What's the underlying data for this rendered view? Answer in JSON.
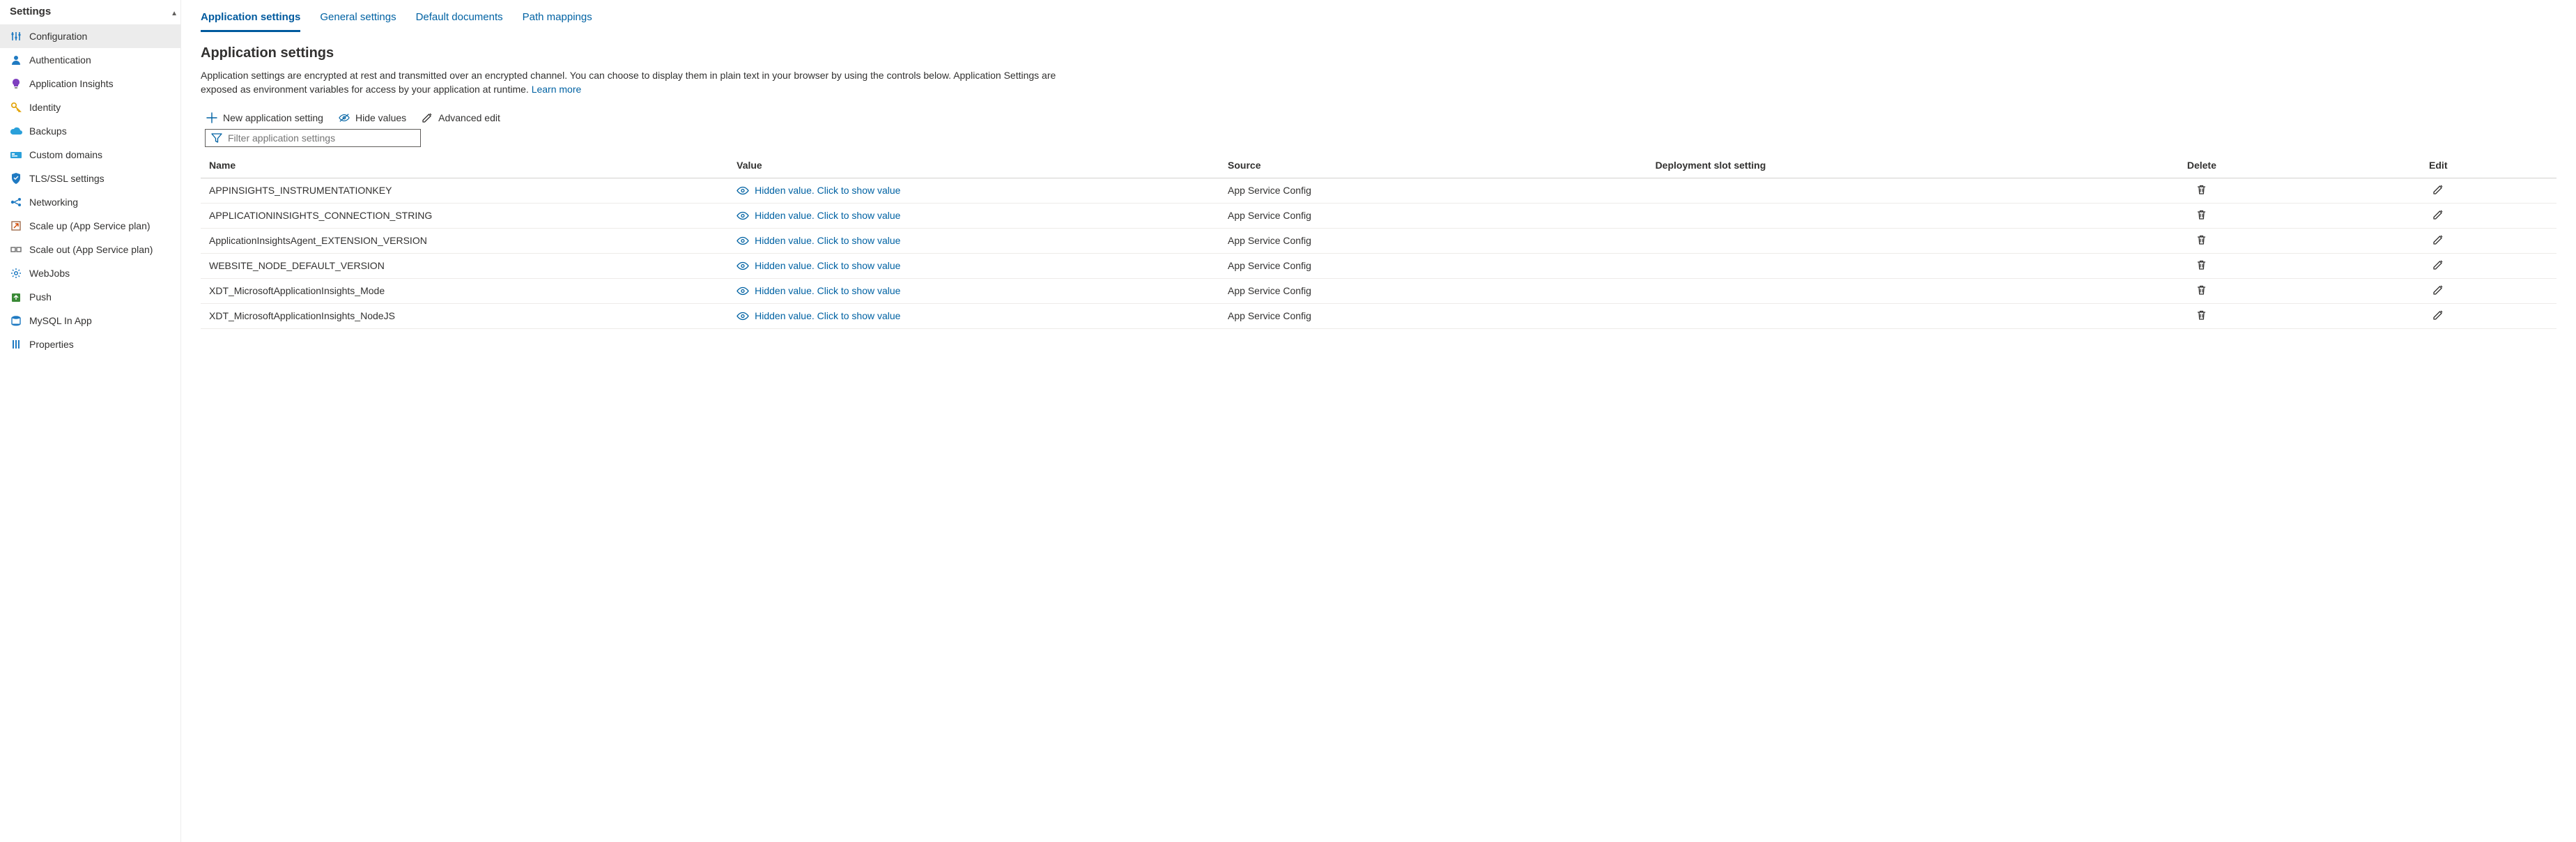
{
  "sidebar": {
    "title": "Settings",
    "items": [
      {
        "label": "Configuration",
        "icon": "sliders",
        "color": "#1f7ac2",
        "active": true
      },
      {
        "label": "Authentication",
        "icon": "person",
        "color": "#1f7ac2",
        "active": false
      },
      {
        "label": "Application Insights",
        "icon": "bulb",
        "color": "#7e3fbf",
        "active": false
      },
      {
        "label": "Identity",
        "icon": "key",
        "color": "#e2a100",
        "active": false
      },
      {
        "label": "Backups",
        "icon": "cloud",
        "color": "#2aa0da",
        "active": false
      },
      {
        "label": "Custom domains",
        "icon": "domains",
        "color": "#2aa0da",
        "active": false
      },
      {
        "label": "TLS/SSL settings",
        "icon": "shield",
        "color": "#1f7ac2",
        "active": false
      },
      {
        "label": "Networking",
        "icon": "network",
        "color": "#1f7ac2",
        "active": false
      },
      {
        "label": "Scale up (App Service plan)",
        "icon": "scaleup",
        "color": "#a06b4d",
        "active": false
      },
      {
        "label": "Scale out (App Service plan)",
        "icon": "scaleout",
        "color": "#6a6a6a",
        "active": false
      },
      {
        "label": "WebJobs",
        "icon": "gear",
        "color": "#1f7ac2",
        "active": false
      },
      {
        "label": "Push",
        "icon": "push",
        "color": "#3a8a36",
        "active": false
      },
      {
        "label": "MySQL In App",
        "icon": "database",
        "color": "#1f7ac2",
        "active": false
      },
      {
        "label": "Properties",
        "icon": "properties",
        "color": "#1f7ac2",
        "active": false
      }
    ]
  },
  "tabs": [
    {
      "label": "Application settings",
      "active": true
    },
    {
      "label": "General settings",
      "active": false
    },
    {
      "label": "Default documents",
      "active": false
    },
    {
      "label": "Path mappings",
      "active": false
    }
  ],
  "section": {
    "title": "Application settings",
    "description_pre": "Application settings are encrypted at rest and transmitted over an encrypted channel. You can choose to display them in plain text in your browser by using the controls below. Application Settings are exposed as environment variables for access by your application at runtime. ",
    "learn_more": "Learn more"
  },
  "toolbar": {
    "new_setting": "New application setting",
    "hide_values": "Hide values",
    "advanced_edit": "Advanced edit"
  },
  "filter": {
    "placeholder": "Filter application settings"
  },
  "table": {
    "headers": {
      "name": "Name",
      "value": "Value",
      "source": "Source",
      "slot": "Deployment slot setting",
      "delete": "Delete",
      "edit": "Edit"
    },
    "hidden_value_text": "Hidden value. Click to show value",
    "rows": [
      {
        "name": "APPINSIGHTS_INSTRUMENTATIONKEY",
        "source": "App Service Config"
      },
      {
        "name": "APPLICATIONINSIGHTS_CONNECTION_STRING",
        "source": "App Service Config"
      },
      {
        "name": "ApplicationInsightsAgent_EXTENSION_VERSION",
        "source": "App Service Config"
      },
      {
        "name": "WEBSITE_NODE_DEFAULT_VERSION",
        "source": "App Service Config"
      },
      {
        "name": "XDT_MicrosoftApplicationInsights_Mode",
        "source": "App Service Config"
      },
      {
        "name": "XDT_MicrosoftApplicationInsights_NodeJS",
        "source": "App Service Config"
      }
    ]
  }
}
